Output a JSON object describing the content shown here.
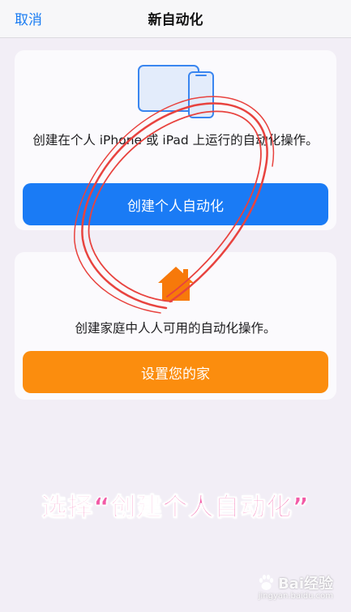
{
  "navbar": {
    "cancel_label": "取消",
    "title": "新自动化"
  },
  "personal_card": {
    "icon": "iphone-ipad-icon",
    "description": "创建在个人 iPhone 或 iPad 上运行的自动化操作。",
    "button_label": "创建个人自动化",
    "button_color": "#1a7bf5"
  },
  "home_card": {
    "icon": "home-icon",
    "description": "创建家庭中人人可用的自动化操作。",
    "button_label": "设置您的家",
    "button_color": "#fb8d0e"
  },
  "annotation": {
    "caption": "选择“创建个人自动化”",
    "caption_color": "#f25aa6",
    "circle_color": "#e8433f"
  },
  "watermark": {
    "brand": "Bai经验",
    "url": "jingyan.baidu.com"
  }
}
